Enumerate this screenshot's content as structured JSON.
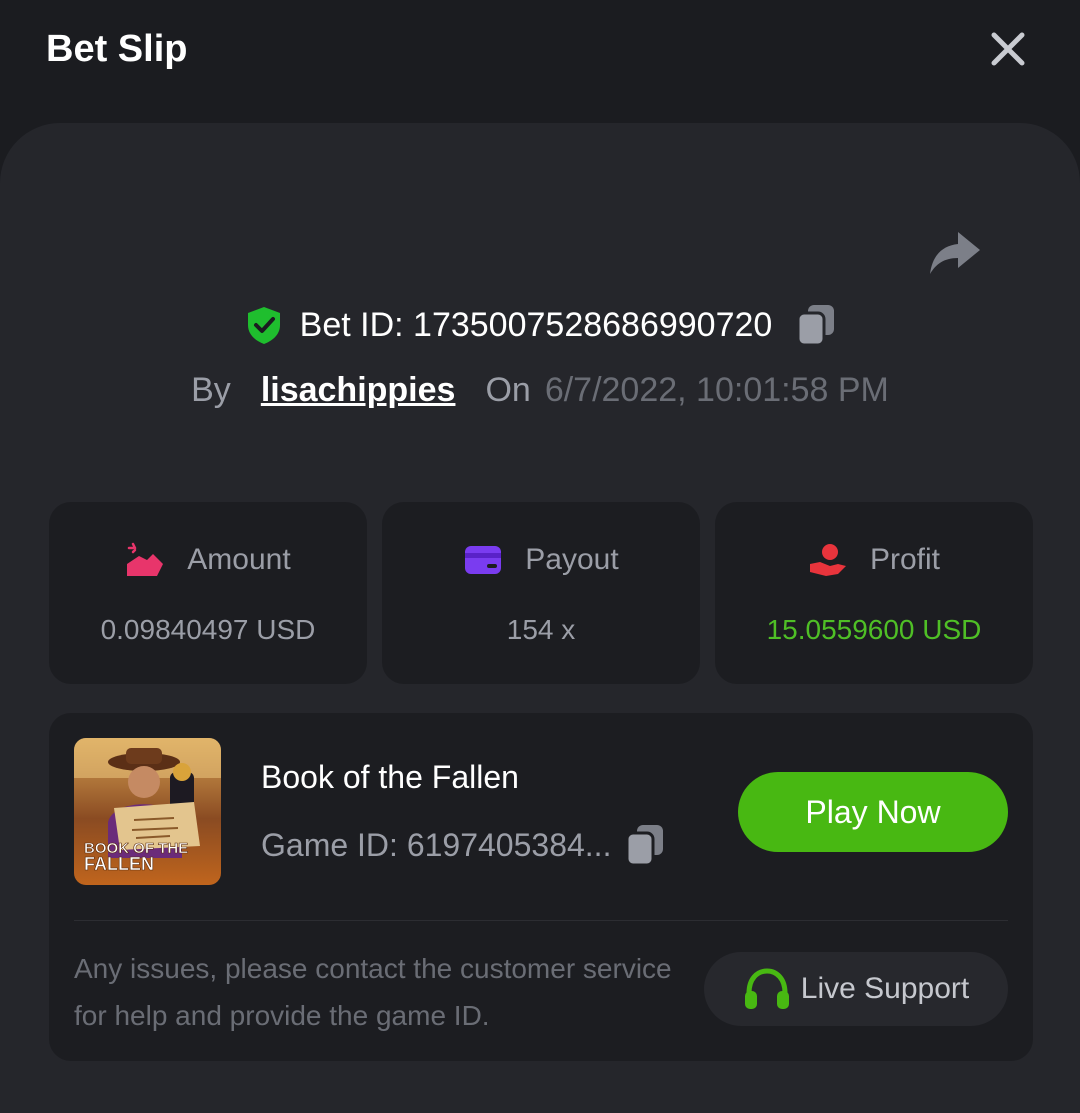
{
  "header": {
    "title": "Bet Slip"
  },
  "bet": {
    "id_text": "Bet ID: 1735007528686990720",
    "by_label": "By",
    "username": "lisachippies",
    "on_label": "On",
    "datetime": "6/7/2022, 10:01:58 PM"
  },
  "stats": {
    "amount": {
      "label": "Amount",
      "value": "0.09840497 USD",
      "icon": "amount-icon",
      "icon_color": "#e8356b"
    },
    "payout": {
      "label": "Payout",
      "value": "154 x",
      "icon": "card-icon",
      "icon_color": "#7a3cf0"
    },
    "profit": {
      "label": "Profit",
      "value": "15.0559600 USD",
      "icon": "hand-coin-icon",
      "icon_color": "#e8343c",
      "value_color": "#4fbf26"
    }
  },
  "game": {
    "name": "Book of the Fallen",
    "id_text": "Game ID: 6197405384...",
    "thumb_text_line1": "BOOK OF THE",
    "thumb_text_line2": "FALLEN",
    "play_label": "Play Now"
  },
  "support": {
    "help_text": "Any issues, please contact the customer service for help and provide the game ID.",
    "button_label": "Live Support"
  },
  "colors": {
    "background": "#1b1c20",
    "card": "#25262b",
    "accent_green": "#48b812",
    "shield_green": "#1fbe2e"
  }
}
